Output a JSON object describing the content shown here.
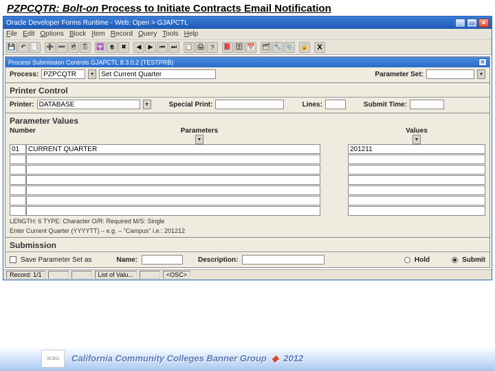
{
  "slideTitle": {
    "prefix": "PZPCQTR: ",
    "bolton": "Bolt-on",
    "rest": " Process to Initiate Contracts Email Notification"
  },
  "window": {
    "title": "Oracle Developer Forms Runtime - Web: Open > GJAPCTL",
    "menu": [
      "File",
      "Edit",
      "Options",
      "Block",
      "Item",
      "Record",
      "Query",
      "Tools",
      "Help"
    ],
    "subtitle": "Process Submission Controls GJAPCTL 8.3.0.2 (TESTPRB)"
  },
  "top": {
    "processLabel": "Process:",
    "processValue": "PZPCQTR",
    "processDesc": "Set Current Quarter",
    "paramSetLabel": "Parameter Set:"
  },
  "printer": {
    "header": "Printer Control",
    "printerLabel": "Printer:",
    "printerValue": "DATABASE",
    "specialLabel": "Special Print:",
    "linesLabel": "Lines:",
    "submitTimeLabel": "Submit Time:"
  },
  "params": {
    "header": "Parameter Values",
    "col1": "Number",
    "col2": "Parameters",
    "col3": "Values",
    "rows": [
      {
        "num": "01",
        "desc": "CURRENT QUARTER",
        "val": "201211"
      }
    ],
    "meta": "LENGTH: 6  TYPE: Character  O/R: Required  M/S: Single",
    "hint": "Enter Current Quarter (YYYYTT) – e.g. – \"Campus\" i.e.: 201212"
  },
  "submission": {
    "header": "Submission",
    "saveChk": "Save Parameter Set as",
    "nameLabel": "Name:",
    "descLabel": "Description:",
    "holdLabel": "Hold",
    "submitLabel": "Submit"
  },
  "status": {
    "record": "Record: 1/1",
    "list": "List of Valu...",
    "osc": "<OSC>"
  },
  "footer": {
    "org": "California Community Colleges Banner Group",
    "year": "2012"
  }
}
